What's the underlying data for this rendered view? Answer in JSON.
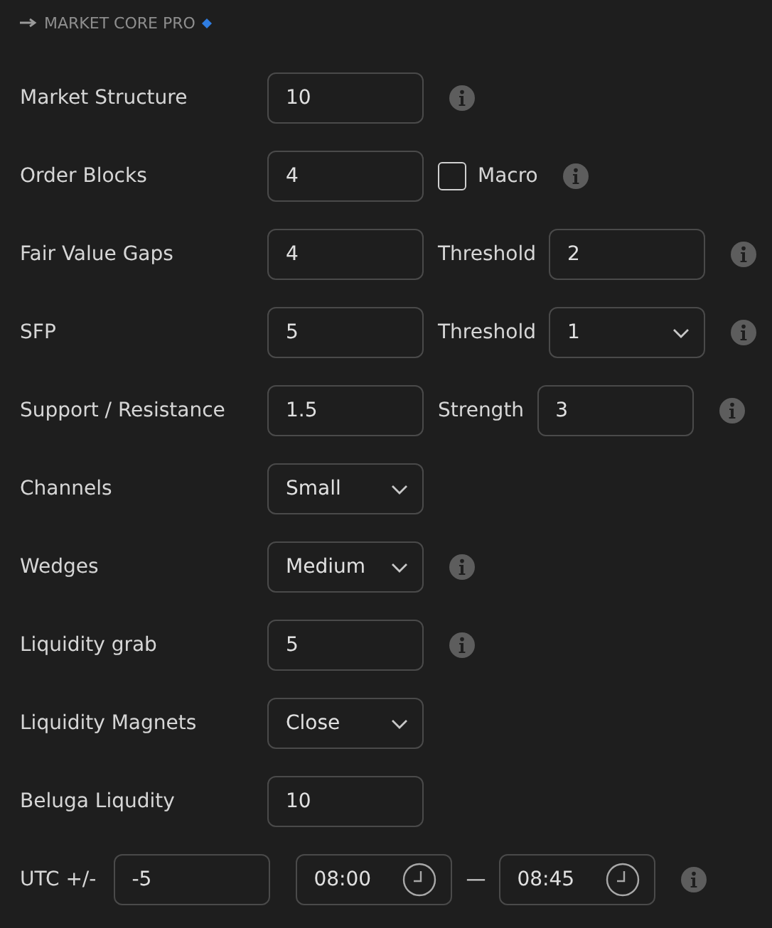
{
  "section": {
    "title": "MARKET CORE PRO"
  },
  "rows": [
    {
      "label": "Market Structure",
      "controls": [
        {
          "kind": "input",
          "value": "10"
        },
        {
          "kind": "info"
        }
      ]
    },
    {
      "label": "Order Blocks",
      "controls": [
        {
          "kind": "input",
          "value": "4"
        },
        {
          "kind": "checkbox",
          "label": "Macro",
          "checked": false
        },
        {
          "kind": "info"
        }
      ]
    },
    {
      "label": "Fair Value Gaps",
      "controls": [
        {
          "kind": "input",
          "value": "4"
        },
        {
          "kind": "text",
          "text": "Threshold"
        },
        {
          "kind": "input",
          "value": "2"
        },
        {
          "kind": "info"
        }
      ]
    },
    {
      "label": "SFP",
      "controls": [
        {
          "kind": "input",
          "value": "5"
        },
        {
          "kind": "text",
          "text": "Threshold"
        },
        {
          "kind": "select",
          "value": "1"
        },
        {
          "kind": "info"
        }
      ]
    },
    {
      "label": "Support / Resistance",
      "controls": [
        {
          "kind": "input",
          "value": "1.5"
        },
        {
          "kind": "text",
          "text": "Strength"
        },
        {
          "kind": "input",
          "value": "3"
        },
        {
          "kind": "info"
        }
      ]
    },
    {
      "label": "Channels",
      "controls": [
        {
          "kind": "select",
          "value": "Small"
        }
      ]
    },
    {
      "label": "Wedges",
      "controls": [
        {
          "kind": "select",
          "value": "Medium"
        },
        {
          "kind": "info"
        }
      ]
    },
    {
      "label": "Liquidity grab",
      "controls": [
        {
          "kind": "input",
          "value": "5"
        },
        {
          "kind": "info"
        }
      ]
    },
    {
      "label": "Liquidity Magnets",
      "controls": [
        {
          "kind": "select",
          "value": "Close"
        }
      ]
    },
    {
      "label": "Beluga Liqudity",
      "controls": [
        {
          "kind": "input",
          "value": "10"
        }
      ]
    },
    {
      "label": "UTC +/-",
      "kind": "inline",
      "controls": [
        {
          "kind": "input",
          "value": "-5"
        },
        {
          "kind": "time",
          "value": "08:00"
        },
        {
          "kind": "text",
          "text": "—"
        },
        {
          "kind": "time",
          "value": "08:45"
        },
        {
          "kind": "info"
        }
      ]
    }
  ]
}
